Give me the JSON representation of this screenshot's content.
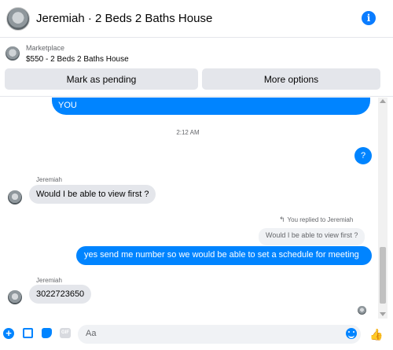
{
  "header": {
    "title": "Jeremiah · 2 Beds 2 Baths House",
    "info_icon": "info-icon"
  },
  "listing": {
    "kind": "Marketplace",
    "price_title": "$550 - 2 Beds 2 Baths House"
  },
  "actions": {
    "pending_label": "Mark as pending",
    "more_label": "More options"
  },
  "messages": {
    "top_outgoing": "YOU",
    "timestamp": "2:12 AM",
    "question_mark": "?",
    "sender_1": "Jeremiah",
    "incoming_1": "Would I be able to view first ?",
    "replied_label": "You replied to Jeremiah",
    "quoted": "Would I be able to view first ?",
    "reply": "yes send me number so we would be able to set a schedule for meeting",
    "sender_2": "Jeremiah",
    "incoming_2": "3022723650"
  },
  "composer": {
    "placeholder": "Aa",
    "gif_label": "GIF"
  },
  "colors": {
    "accent": "#0084ff",
    "bubble_in": "#e4e6eb"
  }
}
